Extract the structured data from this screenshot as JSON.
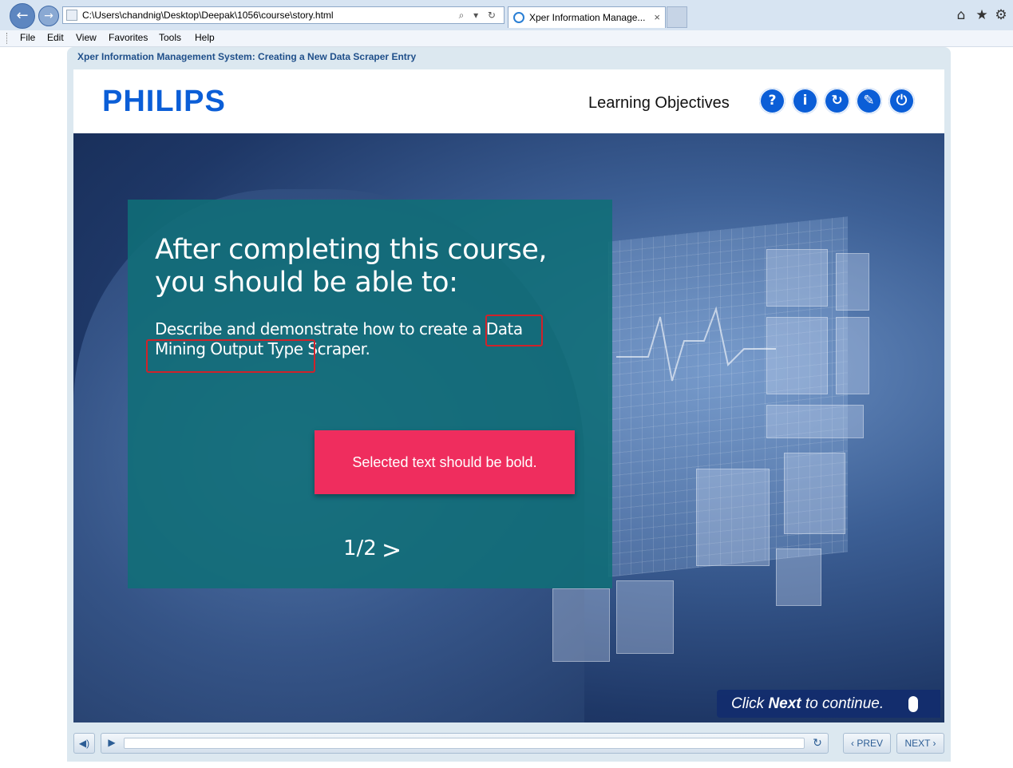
{
  "browser": {
    "address": "C:\\Users\\chandnig\\Desktop\\Deepak\\1056\\course\\story.html",
    "tab_title": "Xper Information Manage...",
    "tab_close": "×",
    "back_icon": "←",
    "forward_icon": "→",
    "address_tools": "⌕ ▾ ↻",
    "home_icon": "⌂",
    "favorites_icon": "★",
    "settings_icon": "⚙"
  },
  "menu": [
    "File",
    "Edit",
    "View",
    "Favorites",
    "Tools",
    "Help"
  ],
  "course": {
    "title": "Xper Information Management System: Creating a New Data Scraper Entry",
    "logo": "PHILIPS",
    "section_title": "Learning Objectives",
    "header_buttons": [
      {
        "name": "help-button",
        "glyph": "?"
      },
      {
        "name": "info-button",
        "glyph": "i"
      },
      {
        "name": "replay-button",
        "glyph": "↻"
      },
      {
        "name": "glossary-button",
        "glyph": "✎"
      },
      {
        "name": "exit-button",
        "glyph": "⏻"
      }
    ]
  },
  "slide": {
    "heading": "After completing this course, you should be able to:",
    "objective": "Describe and demonstrate how to create a Data Mining Output Type Scraper.",
    "review_note": "Selected text should be bold.",
    "page_indicator": "1/2",
    "next_arrow": ">",
    "cta_prefix": "Click ",
    "cta_bold": "Next",
    "cta_suffix": " to continue."
  },
  "controls": {
    "volume_icon": "◀)",
    "play_icon": "▶",
    "replay_icon": "↻",
    "prev_label": "‹ PREV",
    "next_label": "NEXT ›"
  },
  "colors": {
    "brand_blue": "#0b5ed7",
    "card_teal": "#106e78",
    "note_pink": "#ef2d5e",
    "annotation_red": "#d0222a"
  }
}
